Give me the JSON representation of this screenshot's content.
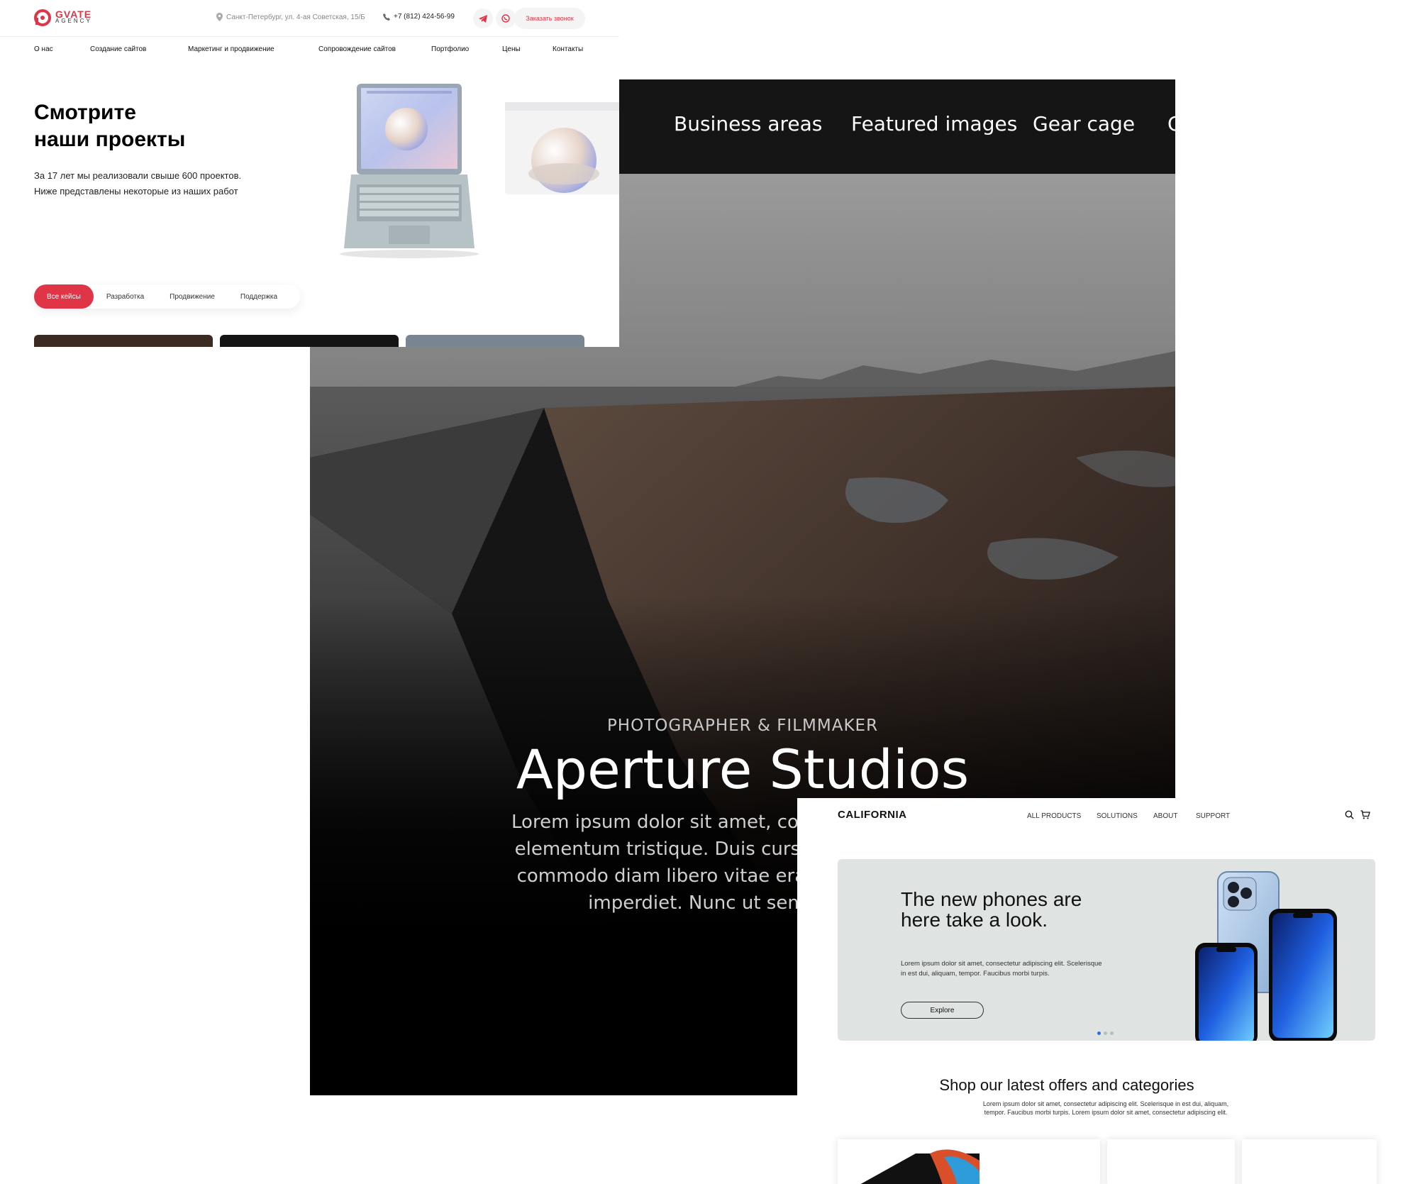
{
  "gvate": {
    "logo": {
      "line1": "GVATE",
      "line2": "AGENCY"
    },
    "address": "Санкт-Петербург, ул. 4-ая Советская, 15/Б",
    "phone": "+7 (812) 424-56-99",
    "callback_button": "Заказать звонок",
    "nav": [
      {
        "label": "О нас"
      },
      {
        "label": "Создание сайтов"
      },
      {
        "label": "Маркетинг и продвижение"
      },
      {
        "label": "Сопровождение сайтов"
      },
      {
        "label": "Портфолио"
      },
      {
        "label": "Цены"
      },
      {
        "label": "Контакты"
      }
    ],
    "heading": {
      "line1": "Смотрите",
      "line2": "наши проекты"
    },
    "intro": {
      "line1": "За 17 лет мы реализовали свыше 600 проектов.",
      "line2": "Ниже представлены некоторые из наших работ"
    },
    "filter_tabs": [
      {
        "label": "Все кейсы"
      },
      {
        "label": "Разработка"
      },
      {
        "label": "Продвижение"
      },
      {
        "label": "Поддержка"
      }
    ],
    "active_tab": "Все кейсы",
    "colors": {
      "accent": "#e03447"
    }
  },
  "aperture": {
    "menu": [
      {
        "label": "Business areas"
      },
      {
        "label": "Featured images"
      },
      {
        "label": "Gear cage"
      },
      {
        "label": "C"
      }
    ],
    "kicker": "PHOTOGRAPHER & FILMMAKER",
    "title": "Aperture Studios",
    "paragraph_lines": [
      "Lorem ipsum dolor sit amet, consectetur adipiscin",
      "elementum tristique. Duis cursus, mi quis viverra",
      "commodo diam libero vitae erat. Aenean faucibu",
      "imperdiet. Nunc ut sem vitae risu"
    ]
  },
  "california": {
    "brand": "CALIFORNIA",
    "nav": [
      {
        "label": "ALL PRODUCTS"
      },
      {
        "label": "SOLUTIONS"
      },
      {
        "label": "ABOUT"
      },
      {
        "label": "SUPPORT"
      }
    ],
    "icons": [
      "search-icon",
      "cart-icon"
    ],
    "hero": {
      "heading": "The new phones are here take a look.",
      "text": "Lorem ipsum dolor sit amet, consectetur adipiscing elit. Scelerisque in est dui, aliquam, tempor. Faucibus morbi turpis.",
      "button": "Explore",
      "slides": 3,
      "active_slide": 1
    },
    "shop": {
      "title": "Shop our latest offers and categories",
      "subtitle": "Lorem ipsum dolor sit amet, consectetur adipiscing elit. Scelerisque in est dui, aliquam, tempor. Faucibus morbi turpis. Lorem ipsum dolor sit amet, consectetur adipiscing elit."
    },
    "colors": {
      "hero_bg": "#dfe3e1",
      "active_dot": "#2f6ee0"
    }
  }
}
